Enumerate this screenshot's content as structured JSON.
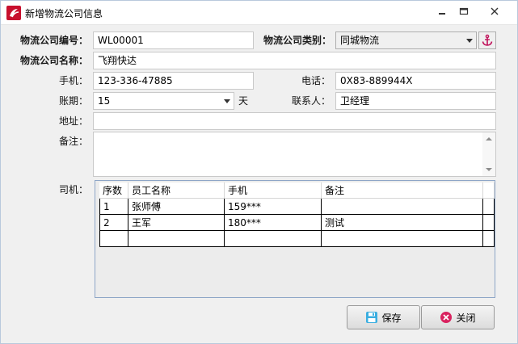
{
  "window": {
    "title": "新增物流公司信息"
  },
  "form": {
    "code_label": "物流公司编号：",
    "code_value": "WL00001",
    "category_label": "物流公司类别：",
    "category_value": "同城物流",
    "name_label": "物流公司名称：",
    "name_value": "飞翔快达",
    "mobile_label": "手机：",
    "mobile_value": "123-336-47885",
    "phone_label": "电话：",
    "phone_value": "0X83-889944X",
    "term_label": "账期：",
    "term_value": "15",
    "term_unit": "天",
    "contact_label": "联系人：",
    "contact_value": "卫经理",
    "address_label": "地址：",
    "address_value": "",
    "remark_label": "备注：",
    "remark_value": "",
    "driver_label": "司机："
  },
  "drivers": {
    "columns": [
      "序数",
      "员工名称",
      "手机",
      "备注"
    ],
    "rows": [
      [
        "1",
        "张师傅",
        "159***",
        ""
      ],
      [
        "2",
        "王军",
        "180***",
        "测试"
      ],
      [
        "",
        "",
        "",
        ""
      ]
    ]
  },
  "buttons": {
    "save_label": "保存",
    "close_label": "关闭"
  },
  "icons": {
    "app": "app-logo-icon",
    "anchor": "anchor-icon",
    "save": "floppy-disk-icon",
    "close": "close-circle-icon"
  },
  "colors": {
    "anchor": "#c0125a",
    "save_icon": "#3aaee0",
    "close_icon": "#d9225f",
    "grid_border": "#8ea6c7"
  }
}
